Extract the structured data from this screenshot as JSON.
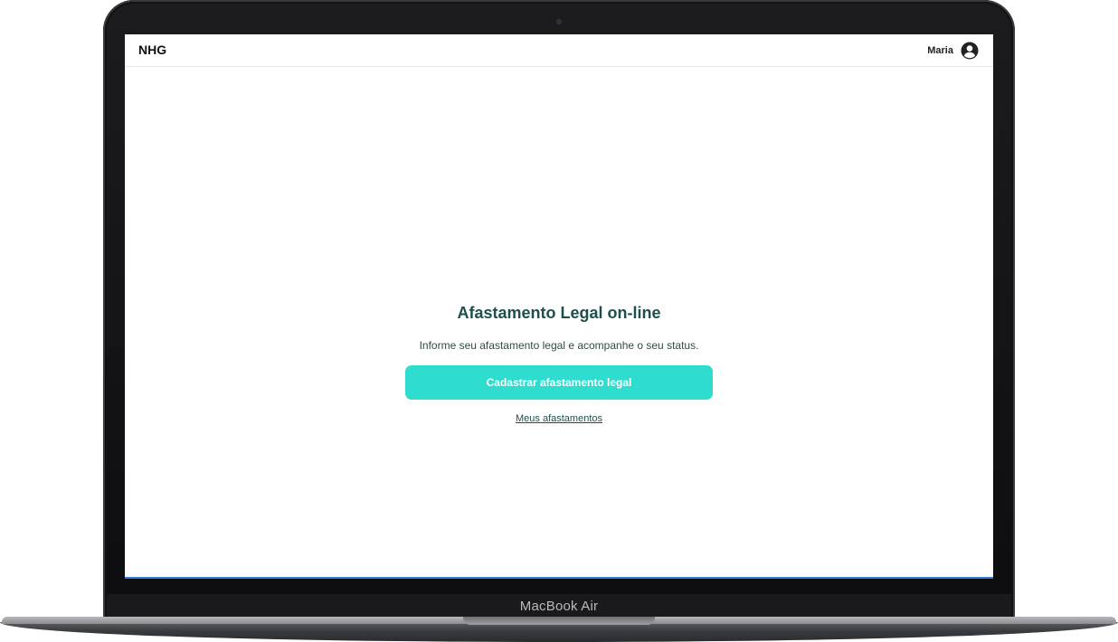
{
  "device": {
    "label": "MacBook Air"
  },
  "header": {
    "logo": "NHG",
    "user_name": "Maria",
    "user_icon": "user-circle-icon"
  },
  "main": {
    "title": "Afastamento Legal on-line",
    "subtitle": "Informe seu afastamento legal e acompanhe o seu status.",
    "primary_button_label": "Cadastrar afastamento legal",
    "secondary_link_label": "Meus afastamentos"
  },
  "colors": {
    "accent": "#2fddcf",
    "heading": "#1f4f4c"
  }
}
